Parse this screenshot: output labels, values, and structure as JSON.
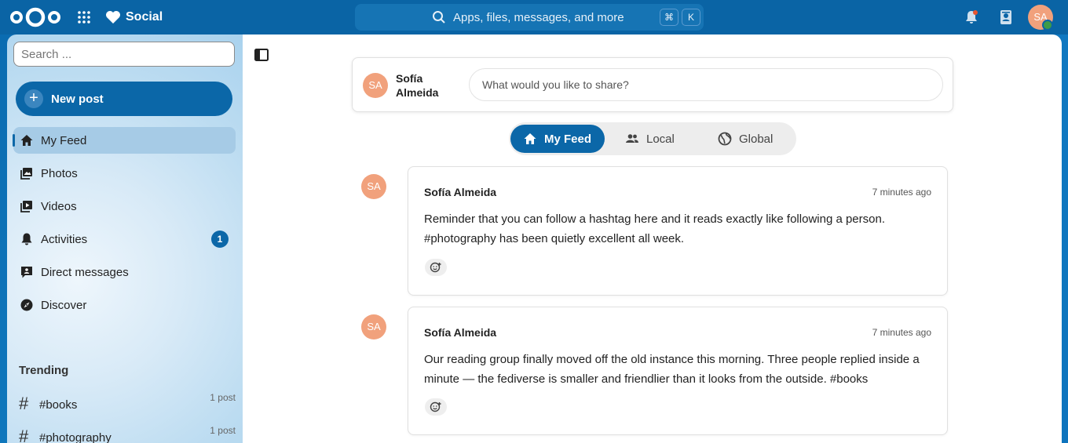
{
  "header": {
    "app_name": "Social",
    "search_placeholder": "Apps, files, messages, and more",
    "shortcut_keys": [
      "⌘",
      "K"
    ],
    "user_initials": "SA"
  },
  "sidebar": {
    "search_placeholder": "Search ...",
    "new_post_label": "New post",
    "nav": [
      {
        "label": "My Feed",
        "icon": "home-icon",
        "active": true
      },
      {
        "label": "Photos",
        "icon": "image-icon"
      },
      {
        "label": "Videos",
        "icon": "video-icon"
      },
      {
        "label": "Activities",
        "icon": "bell-icon",
        "badge": "1"
      },
      {
        "label": "Direct messages",
        "icon": "message-icon"
      },
      {
        "label": "Discover",
        "icon": "compass-icon"
      }
    ],
    "trending_title": "Trending",
    "trending": [
      {
        "tag": "#books",
        "count": "1 post"
      },
      {
        "tag": "#photography",
        "count": "1 post"
      }
    ]
  },
  "composer": {
    "user_initials": "SA",
    "user_name": "Sofía Almeida",
    "placeholder": "What would you like to share?"
  },
  "tabs": [
    {
      "label": "My Feed",
      "icon": "home-icon",
      "active": true
    },
    {
      "label": "Local",
      "icon": "people-icon"
    },
    {
      "label": "Global",
      "icon": "globe-icon"
    }
  ],
  "posts": [
    {
      "initials": "SA",
      "author": "Sofía Almeida",
      "time": "7 minutes ago",
      "text": "Reminder that you can follow a hashtag here and it reads exactly like following a person. #photography has been quietly excellent all week."
    },
    {
      "initials": "SA",
      "author": "Sofía Almeida",
      "time": "7 minutes ago",
      "text": "Our reading group finally moved off the old instance this morning. Three people replied inside a minute — the fediverse is smaller and friendlier than it looks from the outside. #books"
    }
  ],
  "colors": {
    "primary": "#0b67a8",
    "avatar": "#f1a17c",
    "online": "#3d9b47"
  }
}
